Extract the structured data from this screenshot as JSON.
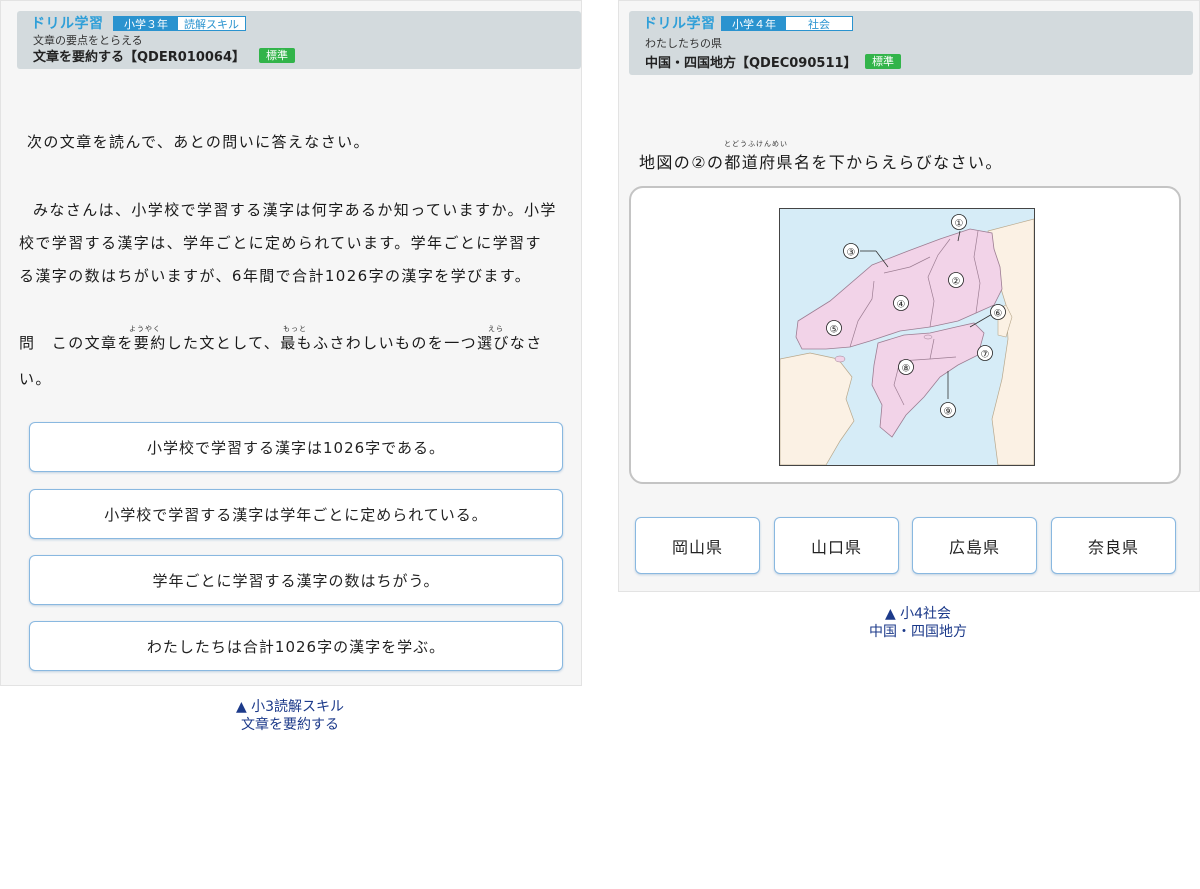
{
  "left": {
    "header": {
      "brand": "ドリル学習",
      "grade": "小学３年",
      "subject": "読解スキル",
      "unit": "文章の要点をとらえる",
      "title": "文章を要約する【QDER010064】",
      "level": "標準"
    },
    "instruction": "次の文章を読んで、あとの問いに答えなさい。",
    "passage_lines": [
      "みなさんは、小学校で学習する漢字は何字あるか知っていますか。小学",
      "校で学習する漢字は、学年ごとに定められています。学年ごとに学習す",
      "る漢字の数はちがいますが、6年間で合計1026字の漢字を学びます。"
    ],
    "question_lines": [
      "問　この文章を要約した文として、最もふさわしいものを一つ選びなさ",
      "い。"
    ],
    "ruby": [
      "ようやく",
      "もっと",
      "えら"
    ],
    "choices": [
      "小学校で学習する漢字は1026字である。",
      "小学校で学習する漢字は学年ごとに定められている。",
      "学年ごとに学習する漢字の数はちがう。",
      "わたしたちは合計1026字の漢字を学ぶ。"
    ],
    "caption": [
      "▲ 小3読解スキル",
      "文章を要約する"
    ]
  },
  "right": {
    "header": {
      "brand": "ドリル学習",
      "grade": "小学４年",
      "subject": "社会",
      "unit": "わたしたちの県",
      "title": "中国・四国地方【QDEC090511】",
      "level": "標準"
    },
    "question": "地図の②の都道府県名を下からえらびなさい。",
    "ruby": "とどうふけんめい",
    "map_labels": [
      "①",
      "②",
      "③",
      "④",
      "⑤",
      "⑥",
      "⑦",
      "⑧",
      "⑨"
    ],
    "choices": [
      "岡山県",
      "山口県",
      "広島県",
      "奈良県"
    ],
    "caption": [
      "▲ 小4社会",
      "中国・四国地方"
    ]
  },
  "colors": {
    "brand_blue": "#2f9fd8",
    "header_bg": "#d3dadd",
    "level_green": "#32b44a",
    "sea": "#d6ecf7",
    "target_region": "#f2d3e8",
    "other_land": "#fbf1e4",
    "caption_blue": "#1c3a8a"
  }
}
